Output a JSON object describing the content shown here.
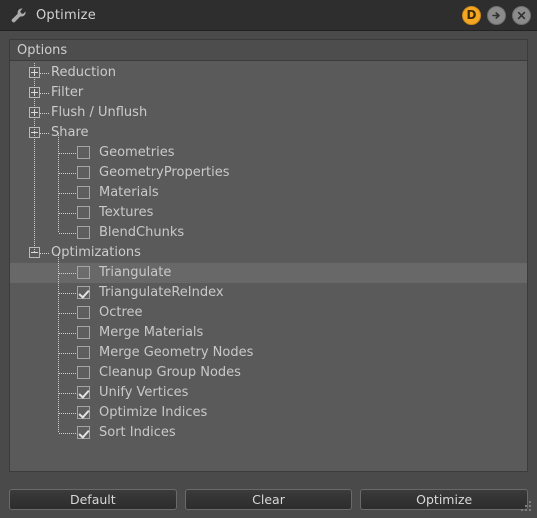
{
  "window": {
    "title": "Optimize",
    "icon": "wrench-icon",
    "background_color": "#4a4a4a",
    "titlebar_color": "#2e2e2e",
    "accent_color": "#f5a623"
  },
  "titlebar_buttons": [
    {
      "name": "dock-button",
      "label": "D",
      "icon": "dock-badge-icon"
    },
    {
      "name": "undock-button",
      "label": "",
      "icon": "arrow-right-icon"
    },
    {
      "name": "close-button",
      "label": "",
      "icon": "close-icon"
    }
  ],
  "panel": {
    "header": "Options"
  },
  "tree": {
    "items": [
      {
        "label": "Reduction",
        "type": "group",
        "expander": "plus",
        "depth": 0,
        "checked": null,
        "highlighted": false
      },
      {
        "label": "Filter",
        "type": "group",
        "expander": "plus",
        "depth": 0,
        "checked": null,
        "highlighted": false
      },
      {
        "label": "Flush / Unflush",
        "type": "group",
        "expander": "plus",
        "depth": 0,
        "checked": null,
        "highlighted": false
      },
      {
        "label": "Share",
        "type": "group",
        "expander": "minus",
        "depth": 0,
        "checked": null,
        "highlighted": false
      },
      {
        "label": "Geometries",
        "type": "item",
        "expander": null,
        "depth": 1,
        "checked": false,
        "highlighted": false
      },
      {
        "label": "GeometryProperties",
        "type": "item",
        "expander": null,
        "depth": 1,
        "checked": false,
        "highlighted": false
      },
      {
        "label": "Materials",
        "type": "item",
        "expander": null,
        "depth": 1,
        "checked": false,
        "highlighted": false
      },
      {
        "label": "Textures",
        "type": "item",
        "expander": null,
        "depth": 1,
        "checked": false,
        "highlighted": false
      },
      {
        "label": "BlendChunks",
        "type": "item",
        "expander": null,
        "depth": 1,
        "checked": false,
        "highlighted": false
      },
      {
        "label": "Optimizations",
        "type": "group",
        "expander": "minus",
        "depth": 0,
        "checked": null,
        "highlighted": false
      },
      {
        "label": "Triangulate",
        "type": "item",
        "expander": null,
        "depth": 1,
        "checked": false,
        "highlighted": true
      },
      {
        "label": "TriangulateReIndex",
        "type": "item",
        "expander": null,
        "depth": 1,
        "checked": true,
        "highlighted": false
      },
      {
        "label": "Octree",
        "type": "item",
        "expander": null,
        "depth": 1,
        "checked": false,
        "highlighted": false
      },
      {
        "label": "Merge Materials",
        "type": "item",
        "expander": null,
        "depth": 1,
        "checked": false,
        "highlighted": false
      },
      {
        "label": "Merge Geometry Nodes",
        "type": "item",
        "expander": null,
        "depth": 1,
        "checked": false,
        "highlighted": false
      },
      {
        "label": "Cleanup Group Nodes",
        "type": "item",
        "expander": null,
        "depth": 1,
        "checked": false,
        "highlighted": false
      },
      {
        "label": "Unify Vertices",
        "type": "item",
        "expander": null,
        "depth": 1,
        "checked": true,
        "highlighted": false
      },
      {
        "label": "Optimize Indices",
        "type": "item",
        "expander": null,
        "depth": 1,
        "checked": true,
        "highlighted": false
      },
      {
        "label": "Sort Indices",
        "type": "item",
        "expander": null,
        "depth": 1,
        "checked": true,
        "highlighted": false
      }
    ]
  },
  "footer": {
    "buttons": [
      {
        "name": "default-button",
        "label": "Default"
      },
      {
        "name": "clear-button",
        "label": "Clear"
      },
      {
        "name": "optimize-button",
        "label": "Optimize"
      }
    ]
  }
}
